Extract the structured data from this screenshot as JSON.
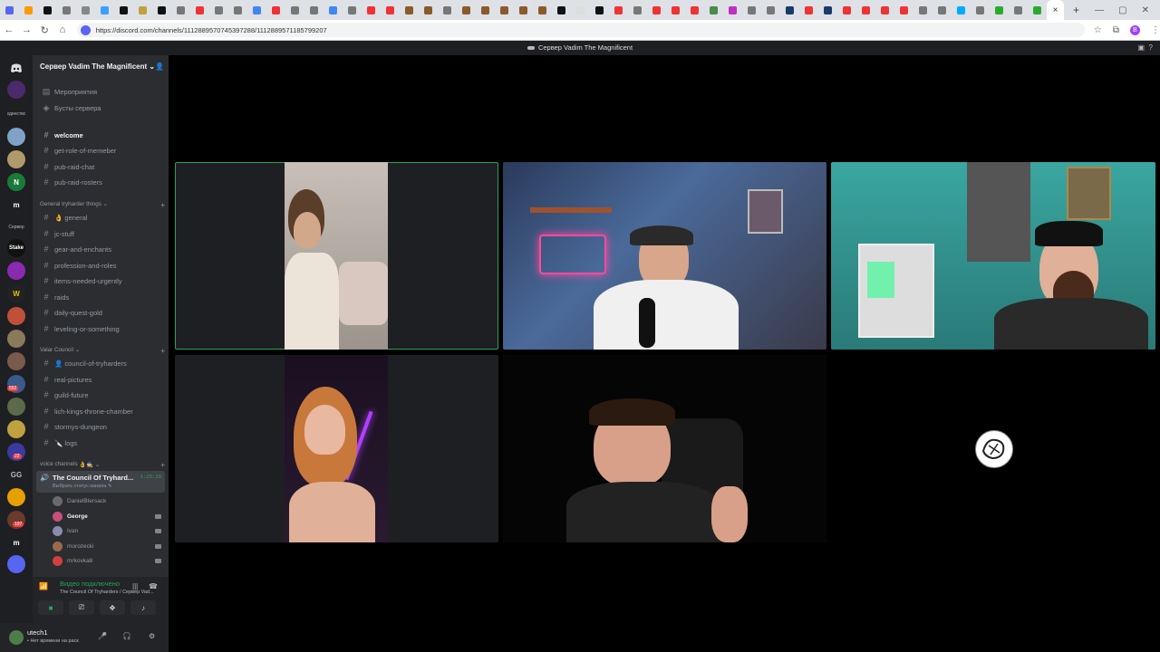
{
  "browser": {
    "url": "https://discord.com/channels/1112889570745397288/1112889571185799207"
  },
  "discord": {
    "window_title": "Сервер Vadim The Magnificent",
    "server_name": "Сервер Vadim The Magnificent",
    "top_items": [
      "Мероприятия",
      "Бусты сервера"
    ],
    "channels_top": [
      "welcome",
      "get-role-of-memeber",
      "pub-raid-chat",
      "pub-raid-rosters"
    ],
    "category1": "General tryharder things",
    "channels_general": [
      "👌 general",
      "jc-stuff",
      "gear-and-enchants",
      "profession-and-roles",
      "items-needed-urgently",
      "raids",
      "daily-quest-gold",
      "leveling-or-something"
    ],
    "category2": "Valar Council",
    "channels_valar": [
      "👤 council-of-tryharders",
      "real-pictures",
      "guild-future",
      "lich-kings-throne-chamber",
      "stormys-dungeon",
      "🔪 logs"
    ],
    "category3": "voice channels",
    "voice_channel": {
      "name": "The Council Of Tryhard...",
      "time": "1:25:29",
      "status": "Выбрать статус канала"
    },
    "voice_users": [
      "DanielBlersack",
      "George",
      "Ivan",
      "morozecki",
      "mrkovka8"
    ],
    "voice_status": {
      "title": "Видео подключено",
      "subtitle": "The Council Of Tryharders / Сервер Vad..."
    },
    "user": {
      "name": "utech1",
      "status": "• Нет времени на раск"
    },
    "rail_labels": {
      "r1": "единство",
      "r2": "Сервер",
      "m1": "m",
      "m2": "m",
      "gg": "GG",
      "stake": "Stake",
      "b1": "552",
      "b2": "22",
      "b3": "197"
    }
  },
  "colors": {
    "accent": "#5865f2",
    "speaking": "#23a55a",
    "sidebar": "#2b2d31",
    "rail": "#1e1f22"
  }
}
